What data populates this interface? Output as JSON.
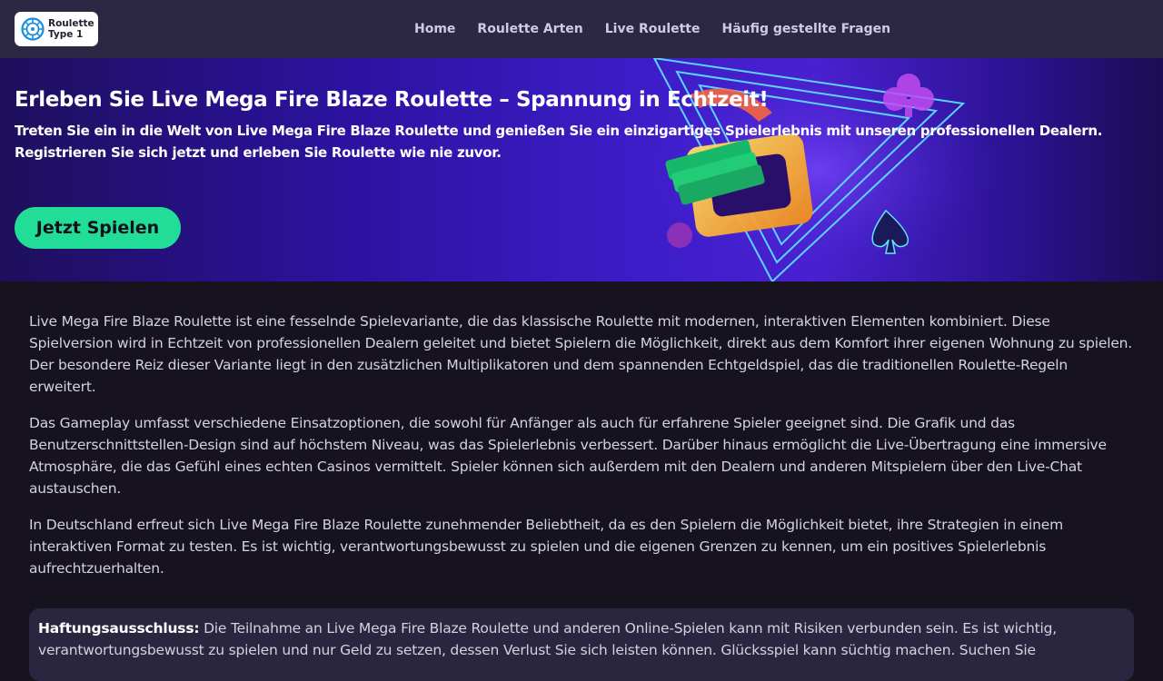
{
  "header": {
    "logo_line1": "Roulette",
    "logo_line2": "Type 1",
    "nav": [
      "Home",
      "Roulette Arten",
      "Live Roulette",
      "Häufig gestellte Fragen"
    ]
  },
  "hero": {
    "title": "Erleben Sie Live Mega Fire Blaze Roulette – Spannung in Echtzeit!",
    "subtitle": "Treten Sie ein in die Welt von Live Mega Fire Blaze Roulette und genießen Sie ein einzigartiges Spielerlebnis mit unseren professionellen Dealern. Registrieren Sie sich jetzt und erleben Sie Roulette wie nie zuvor.",
    "cta_label": "Jetzt Spielen"
  },
  "content": {
    "paragraphs": [
      "Live Mega Fire Blaze Roulette ist eine fesselnde Spielevariante, die das klassische Roulette mit modernen, interaktiven Elementen kombiniert. Diese Spielversion wird in Echtzeit von professionellen Dealern geleitet und bietet Spielern die Möglichkeit, direkt aus dem Komfort ihrer eigenen Wohnung zu spielen. Der besondere Reiz dieser Variante liegt in den zusätzlichen Multiplikatoren und dem spannenden Echtgeldspiel, das die traditionellen Roulette-Regeln erweitert.",
      "Das Gameplay umfasst verschiedene Einsatzoptionen, die sowohl für Anfänger als auch für erfahrene Spieler geeignet sind. Die Grafik und das Benutzerschnittstellen-Design sind auf höchstem Niveau, was das Spielerlebnis verbessert. Darüber hinaus ermöglicht die Live-Übertragung eine immersive Atmosphäre, die das Gefühl eines echten Casinos vermittelt. Spieler können sich außerdem mit den Dealern und anderen Mitspielern über den Live-Chat austauschen.",
      "In Deutschland erfreut sich Live Mega Fire Blaze Roulette zunehmender Beliebtheit, da es den Spielern die Möglichkeit bietet, ihre Strategien in einem interaktiven Format zu testen. Es ist wichtig, verantwortungsbewusst zu spielen und die eigenen Grenzen zu kennen, um ein positives Spielerlebnis aufrechtzuerhalten."
    ]
  },
  "disclaimer": {
    "label": "Haftungsausschluss:",
    "text": " Die Teilnahme an Live Mega Fire Blaze Roulette und anderen Online-Spielen kann mit Risiken verbunden sein. Es ist wichtig, verantwortungsbewusst zu spielen und nur Geld zu setzen, dessen Verlust Sie sich leisten können. Glücksspiel kann süchtig machen. Suchen Sie"
  },
  "colors": {
    "header_bg": "#2c2742",
    "page_bg": "#16131f",
    "cta_bg": "#22dd98",
    "hero_bg": "#3c1dc8"
  }
}
